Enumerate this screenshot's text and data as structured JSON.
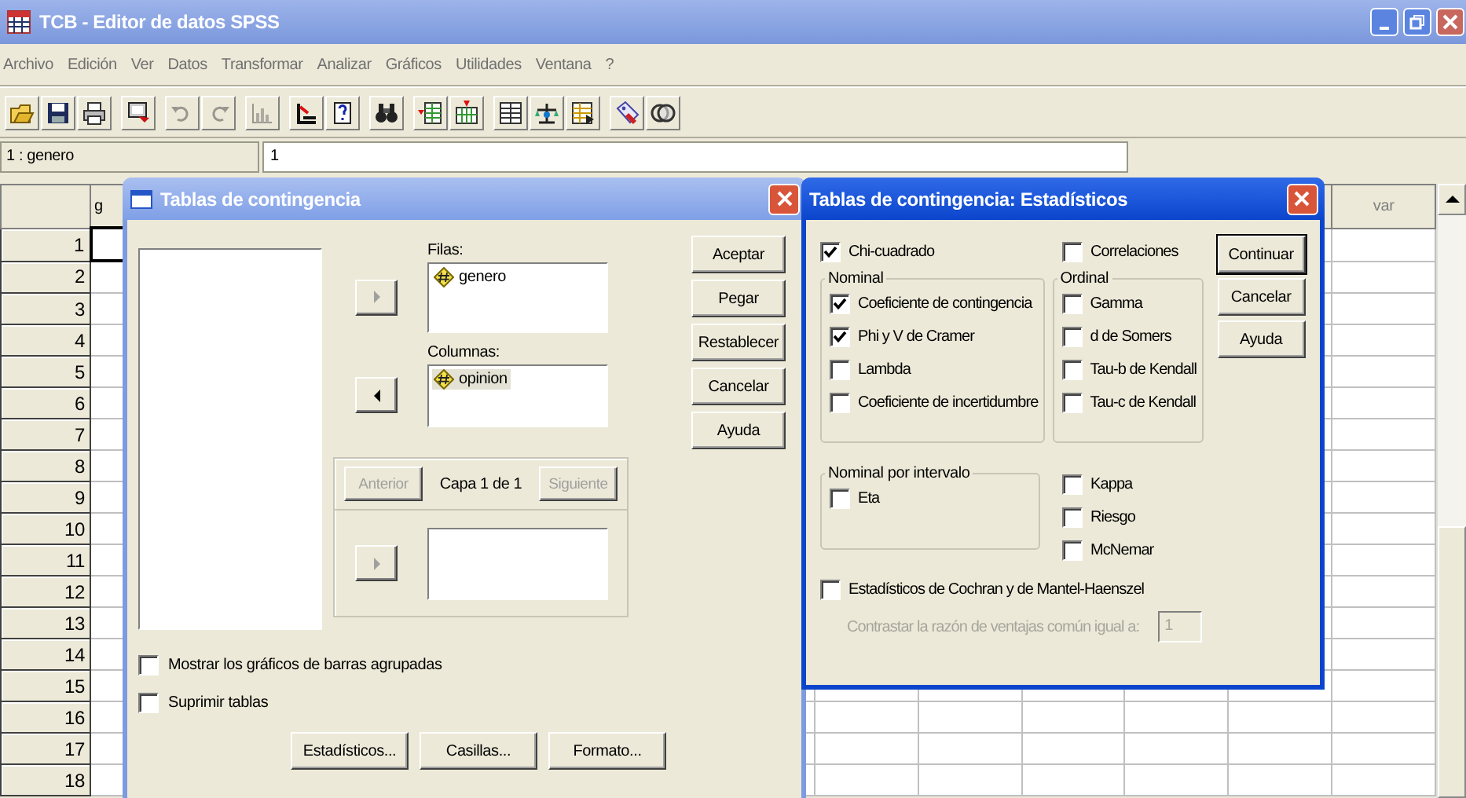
{
  "window": {
    "title": "TCB - Editor de datos SPSS",
    "active": false
  },
  "menu": [
    "Archivo",
    "Edición",
    "Ver",
    "Datos",
    "Transformar",
    "Analizar",
    "Gráficos",
    "Utilidades",
    "Ventana",
    "?"
  ],
  "toolbar": [
    [
      {
        "kind": "open",
        "disabled": false
      },
      {
        "kind": "save",
        "disabled": false
      },
      {
        "kind": "print",
        "disabled": false
      }
    ],
    [
      {
        "kind": "recall",
        "disabled": false
      }
    ],
    [
      {
        "kind": "undo",
        "disabled": true
      },
      {
        "kind": "redo",
        "disabled": true
      }
    ],
    [
      {
        "kind": "chart",
        "disabled": true
      }
    ],
    [
      {
        "kind": "goto",
        "disabled": false
      },
      {
        "kind": "variables",
        "disabled": false
      }
    ],
    [
      {
        "kind": "find",
        "disabled": false
      }
    ],
    [
      {
        "kind": "insert_case",
        "disabled": false
      },
      {
        "kind": "insert_variable",
        "disabled": false
      }
    ],
    [
      {
        "kind": "split",
        "disabled": false
      },
      {
        "kind": "weight",
        "disabled": false
      },
      {
        "kind": "select",
        "disabled": false
      }
    ],
    [
      {
        "kind": "labels",
        "disabled": false
      },
      {
        "kind": "sets",
        "disabled": false
      }
    ]
  ],
  "cell_bar": {
    "reference": "1 : genero",
    "value": "1"
  },
  "grid": {
    "first_header": "g",
    "last_header": "var",
    "rows": [
      {
        "number": "1",
        "active": true
      },
      {
        "number": "2",
        "active": false
      },
      {
        "number": "3",
        "active": false
      },
      {
        "number": "4",
        "active": false
      },
      {
        "number": "5",
        "active": false
      },
      {
        "number": "6",
        "active": false
      },
      {
        "number": "7",
        "active": false
      },
      {
        "number": "8",
        "active": false
      },
      {
        "number": "9",
        "active": false
      },
      {
        "number": "10",
        "active": false
      },
      {
        "number": "11",
        "active": false
      },
      {
        "number": "12",
        "active": false
      },
      {
        "number": "13",
        "active": false
      },
      {
        "number": "14",
        "active": false
      },
      {
        "number": "15",
        "active": false
      },
      {
        "number": "16",
        "active": false
      },
      {
        "number": "17",
        "active": false
      },
      {
        "number": "18",
        "active": false
      }
    ]
  },
  "crosstabs_dialog": {
    "title": "Tablas de contingencia",
    "active": false,
    "rows_label": "Filas:",
    "rows_vars": [
      {
        "name": "genero",
        "selected": false
      }
    ],
    "columns_label": "Columnas:",
    "columns_vars": [
      {
        "name": "opinion",
        "selected": true
      }
    ],
    "arrows": [
      {
        "kind": "move_right",
        "disabled": true
      },
      {
        "kind": "move_left",
        "disabled": false
      },
      {
        "kind": "move_right",
        "disabled": true
      }
    ],
    "layer": {
      "previous": {
        "label": "Anterior",
        "disabled": true
      },
      "label": "Capa 1 de 1",
      "next": {
        "label": "Siguiente",
        "disabled": true
      }
    },
    "side_buttons": [
      "Aceptar",
      "Pegar",
      "Restablecer",
      "Cancelar",
      "Ayuda"
    ],
    "options": [
      {
        "label": "Mostrar los gráficos de barras agrupadas",
        "checked": false
      },
      {
        "label": "Suprimir tablas",
        "checked": false
      }
    ],
    "bottom_buttons": [
      "Estadísticos...",
      "Casillas...",
      "Formato..."
    ]
  },
  "statistics_dialog": {
    "title": "Tablas de contingencia: Estadísticos",
    "active": true,
    "chi_square": {
      "label": "Chi-cuadrado",
      "checked": true
    },
    "correlations": {
      "label": "Correlaciones",
      "checked": false
    },
    "nominal": {
      "title": "Nominal",
      "items": [
        {
          "label": "Coeficiente de contingencia",
          "checked": true
        },
        {
          "label": "Phi y V de Cramer",
          "checked": true
        },
        {
          "label": "Lambda",
          "checked": false
        },
        {
          "label": "Coeficiente de incertidumbre",
          "checked": false
        }
      ]
    },
    "ordinal": {
      "title": "Ordinal",
      "items": [
        {
          "label": "Gamma",
          "checked": false
        },
        {
          "label": "d de Somers",
          "checked": false
        },
        {
          "label": "Tau-b de Kendall",
          "checked": false
        },
        {
          "label": "Tau-c de Kendall",
          "checked": false
        }
      ]
    },
    "nominal_by_interval": {
      "title": "Nominal por intervalo",
      "items": [
        {
          "label": "Eta",
          "checked": false
        }
      ]
    },
    "other": [
      {
        "label": "Kappa",
        "checked": false
      },
      {
        "label": "Riesgo",
        "checked": false
      },
      {
        "label": "McNemar",
        "checked": false
      }
    ],
    "cochran": {
      "label": "Estadísticos de Cochran y de Mantel-Haenszel",
      "checked": false
    },
    "odds_ratio": {
      "label": "Contrastar la razón de ventajas común igual a:",
      "value": "1",
      "disabled": true
    },
    "buttons": [
      {
        "label": "Continuar",
        "default": true
      },
      {
        "label": "Cancelar",
        "default": false
      },
      {
        "label": "Ayuda",
        "default": false
      }
    ]
  }
}
